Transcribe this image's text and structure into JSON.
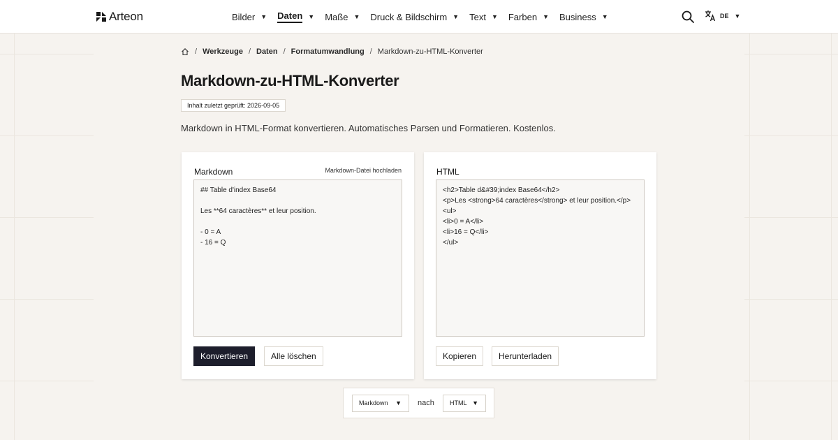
{
  "brand": {
    "name": "Arteon"
  },
  "nav": {
    "items": [
      {
        "label": "Bilder"
      },
      {
        "label": "Daten"
      },
      {
        "label": "Maße"
      },
      {
        "label": "Druck & Bildschirm"
      },
      {
        "label": "Text"
      },
      {
        "label": "Farben"
      },
      {
        "label": "Business"
      }
    ],
    "active_index": 1,
    "caret": "▼"
  },
  "language": {
    "code": "DE"
  },
  "breadcrumb": {
    "items": [
      "Werkzeuge",
      "Daten",
      "Formatumwandlung"
    ],
    "current": "Markdown-zu-HTML-Konverter",
    "separator": "/"
  },
  "page": {
    "title": "Markdown-zu-HTML-Konverter",
    "badge": "Inhalt zuletzt geprüft: 2026-09-05",
    "description": "Markdown in HTML-Format konvertieren. Automatisches Parsen und Formatieren. Kostenlos."
  },
  "input_panel": {
    "title": "Markdown",
    "upload_label": "Markdown-Datei hochladen",
    "value": "## Table d'index Base64\n\nLes **64 caractères** et leur position.\n\n- 0 = A\n- 16 = Q",
    "convert_label": "Konvertieren",
    "clear_label": "Alle löschen"
  },
  "output_panel": {
    "title": "HTML",
    "value": "<h2>Table d&#39;index Base64</h2>\n<p>Les <strong>64 caractères</strong> et leur position.</p>\n<ul>\n<li>0 = A</li>\n<li>16 = Q</li>\n</ul>",
    "copy_label": "Kopieren",
    "download_label": "Herunterladen"
  },
  "format_selector": {
    "from": "Markdown",
    "connector": "nach",
    "to": "HTML"
  }
}
